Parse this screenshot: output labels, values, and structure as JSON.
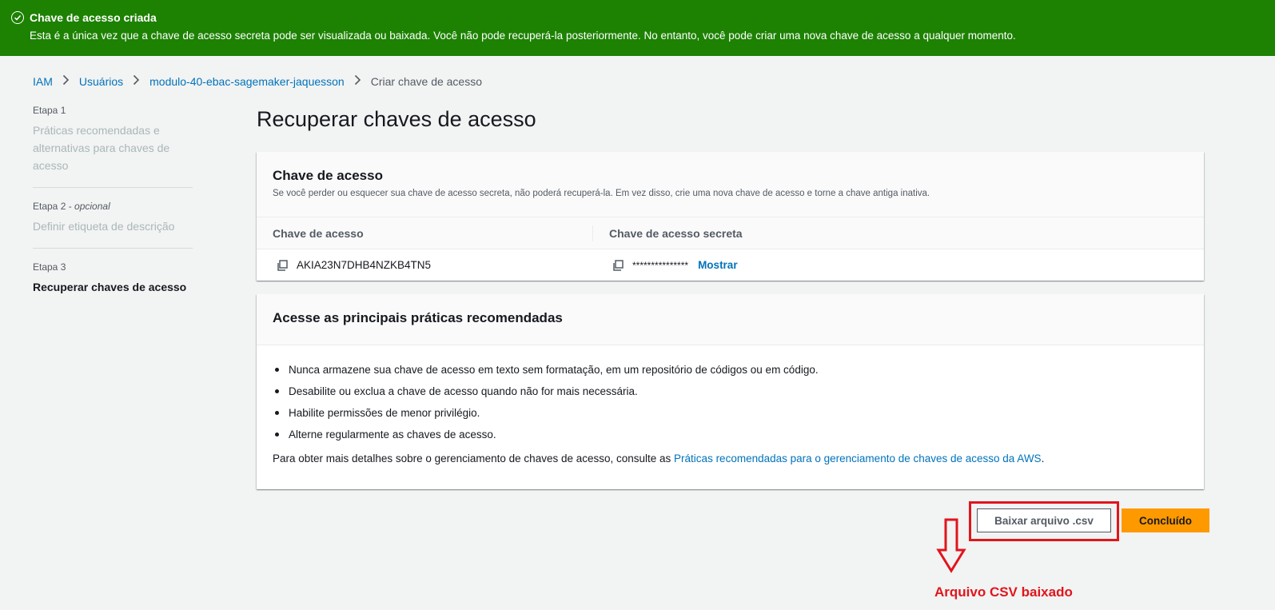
{
  "flash": {
    "title": "Chave de acesso criada",
    "message": "Esta é a única vez que a chave de acesso secreta pode ser visualizada ou baixada. Você não pode recuperá-la posteriormente. No entanto, você pode criar uma nova chave de acesso a qualquer momento.",
    "color": "#1d8102"
  },
  "breadcrumb": {
    "items": [
      "IAM",
      "Usuários",
      "modulo-40-ebac-sagemaker-jaquesson"
    ],
    "current": "Criar chave de acesso"
  },
  "steps": [
    {
      "label": "Etapa 1",
      "optional": "",
      "title": "Práticas recomendadas e alternativas para chaves de acesso"
    },
    {
      "label": "Etapa 2 -",
      "optional": "opcional",
      "title": "Definir etiqueta de descrição"
    },
    {
      "label": "Etapa 3",
      "optional": "",
      "title": "Recuperar chaves de acesso"
    }
  ],
  "page_title": "Recuperar chaves de acesso",
  "access_key_panel": {
    "title": "Chave de acesso",
    "description": "Se você perder ou esquecer sua chave de acesso secreta, não poderá recuperá-la. Em vez disso, crie uma nova chave de acesso e torne a chave antiga inativa.",
    "col_access_key": "Chave de acesso",
    "col_secret_key": "Chave de acesso secreta",
    "access_key_value": "AKIA23N7DHB4NZKB4TN5",
    "secret_key_masked": "***************",
    "show_label": "Mostrar"
  },
  "best_practices_panel": {
    "title": "Acesse as principais práticas recomendadas",
    "items": [
      "Nunca armazene sua chave de acesso em texto sem formatação, em um repositório de códigos ou em código.",
      "Desabilite ou exclua a chave de acesso quando não for mais necessária.",
      "Habilite permissões de menor privilégio.",
      "Alterne regularmente as chaves de acesso."
    ],
    "more_info_prefix": "Para obter mais detalhes sobre o gerenciamento de chaves de acesso, consulte as ",
    "more_info_link": "Práticas recomendadas para o gerenciamento de chaves de acesso da AWS",
    "more_info_suffix": "."
  },
  "actions": {
    "download_csv": "Baixar arquivo .csv",
    "done": "Concluído",
    "primary_color": "#ff9900"
  },
  "annotation": {
    "text": "Arquivo CSV baixado",
    "color": "#e0161c"
  }
}
